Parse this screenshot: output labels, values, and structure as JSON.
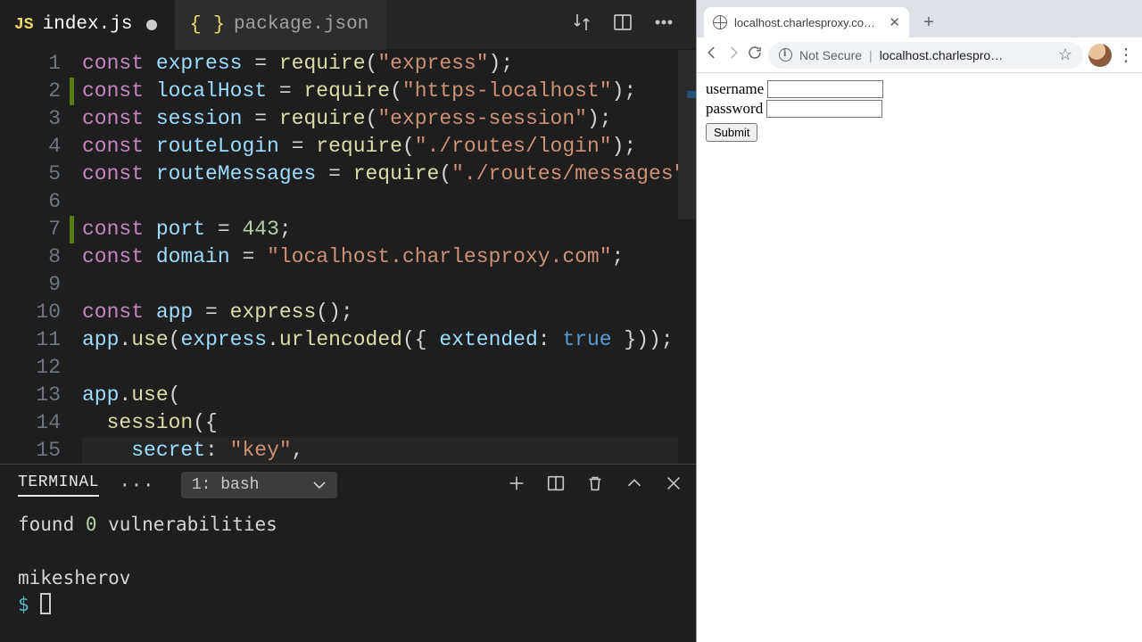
{
  "editor": {
    "tabs": [
      {
        "icon": "js",
        "label": "index.js",
        "active": true,
        "modified": true
      },
      {
        "icon": "braces",
        "label": "package.json",
        "active": false,
        "modified": false
      }
    ],
    "lines_start": 1,
    "lines_end": 15,
    "changed_lines": [
      2,
      7
    ],
    "highlighted_line": 15,
    "code": [
      [
        [
          "kw",
          "const"
        ],
        [
          "pun",
          " "
        ],
        [
          "var",
          "express"
        ],
        [
          "pun",
          " = "
        ],
        [
          "fn",
          "require"
        ],
        [
          "pun",
          "("
        ],
        [
          "str",
          "\"express\""
        ],
        [
          "pun",
          ");"
        ]
      ],
      [
        [
          "kw",
          "const"
        ],
        [
          "pun",
          " "
        ],
        [
          "var",
          "localHost"
        ],
        [
          "pun",
          " = "
        ],
        [
          "fn",
          "require"
        ],
        [
          "pun",
          "("
        ],
        [
          "str",
          "\"https-localhost\""
        ],
        [
          "pun",
          ");"
        ]
      ],
      [
        [
          "kw",
          "const"
        ],
        [
          "pun",
          " "
        ],
        [
          "var",
          "session"
        ],
        [
          "pun",
          " = "
        ],
        [
          "fn",
          "require"
        ],
        [
          "pun",
          "("
        ],
        [
          "str",
          "\"express-session\""
        ],
        [
          "pun",
          ");"
        ]
      ],
      [
        [
          "kw",
          "const"
        ],
        [
          "pun",
          " "
        ],
        [
          "var",
          "routeLogin"
        ],
        [
          "pun",
          " = "
        ],
        [
          "fn",
          "require"
        ],
        [
          "pun",
          "("
        ],
        [
          "str",
          "\"./routes/login\""
        ],
        [
          "pun",
          ");"
        ]
      ],
      [
        [
          "kw",
          "const"
        ],
        [
          "pun",
          " "
        ],
        [
          "var",
          "routeMessages"
        ],
        [
          "pun",
          " = "
        ],
        [
          "fn",
          "require"
        ],
        [
          "pun",
          "("
        ],
        [
          "str",
          "\"./routes/messages\""
        ],
        [
          "pun",
          ");"
        ]
      ],
      [],
      [
        [
          "kw",
          "const"
        ],
        [
          "pun",
          " "
        ],
        [
          "var",
          "port"
        ],
        [
          "pun",
          " = "
        ],
        [
          "num",
          "443"
        ],
        [
          "pun",
          ";"
        ]
      ],
      [
        [
          "kw",
          "const"
        ],
        [
          "pun",
          " "
        ],
        [
          "var",
          "domain"
        ],
        [
          "pun",
          " = "
        ],
        [
          "str",
          "\"localhost.charlesproxy.com\""
        ],
        [
          "pun",
          ";"
        ]
      ],
      [],
      [
        [
          "kw",
          "const"
        ],
        [
          "pun",
          " "
        ],
        [
          "var",
          "app"
        ],
        [
          "pun",
          " = "
        ],
        [
          "fn",
          "express"
        ],
        [
          "pun",
          "();"
        ]
      ],
      [
        [
          "var",
          "app"
        ],
        [
          "pun",
          "."
        ],
        [
          "fn",
          "use"
        ],
        [
          "pun",
          "("
        ],
        [
          "var",
          "express"
        ],
        [
          "pun",
          "."
        ],
        [
          "fn",
          "urlencoded"
        ],
        [
          "pun",
          "({ "
        ],
        [
          "prop",
          "extended"
        ],
        [
          "pun",
          ": "
        ],
        [
          "bool",
          "true"
        ],
        [
          "pun",
          " }));"
        ]
      ],
      [],
      [
        [
          "var",
          "app"
        ],
        [
          "pun",
          "."
        ],
        [
          "fn",
          "use"
        ],
        [
          "pun",
          "("
        ]
      ],
      [
        [
          "pun",
          "  "
        ],
        [
          "fn",
          "session"
        ],
        [
          "pun",
          "({"
        ]
      ],
      [
        [
          "pun",
          "    "
        ],
        [
          "prop",
          "secret"
        ],
        [
          "pun",
          ": "
        ],
        [
          "str",
          "\"key\""
        ],
        [
          "pun",
          ","
        ]
      ]
    ]
  },
  "terminal": {
    "tab_label": "TERMINAL",
    "shell": "1: bash",
    "output_prefix": "found ",
    "output_count": "0",
    "output_suffix": " vulnerabilities",
    "prompt_user": "mikesherov",
    "prompt_symbol": "$"
  },
  "browser": {
    "tab_title": "localhost.charlesproxy.com/lo",
    "security": "Not Secure",
    "url": "localhost.charlespro…",
    "form": {
      "username_label": "username",
      "password_label": "password",
      "submit_label": "Submit"
    }
  }
}
